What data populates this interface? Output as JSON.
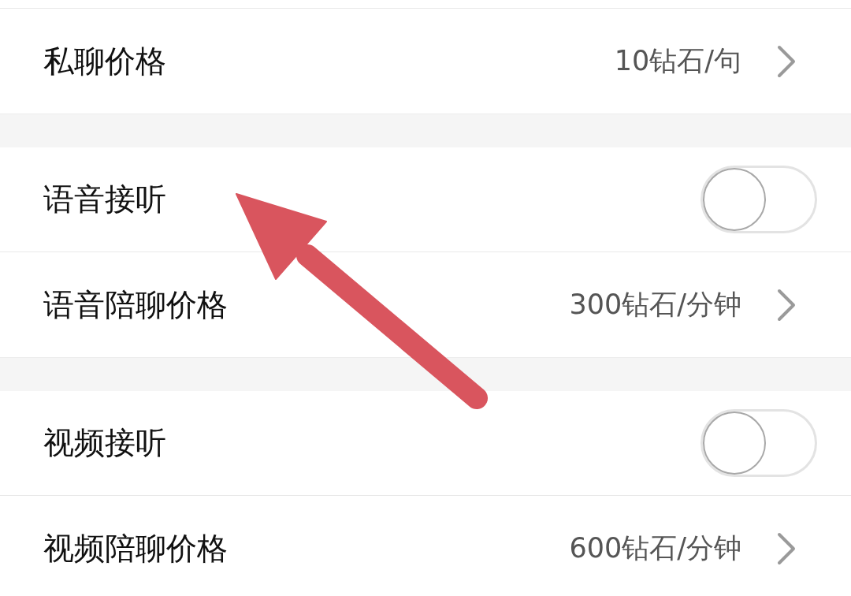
{
  "sections": [
    {
      "rows": [
        {
          "kind": "value",
          "label": "私聊价格",
          "value": "10钻石/句"
        }
      ]
    },
    {
      "rows": [
        {
          "kind": "toggle",
          "label": "语音接听",
          "on": false
        },
        {
          "kind": "value",
          "label": "语音陪聊价格",
          "value": "300钻石/分钟"
        }
      ]
    },
    {
      "rows": [
        {
          "kind": "toggle",
          "label": "视频接听",
          "on": false
        },
        {
          "kind": "value",
          "label": "视频陪聊价格",
          "value": "600钻石/分钟"
        }
      ]
    }
  ]
}
